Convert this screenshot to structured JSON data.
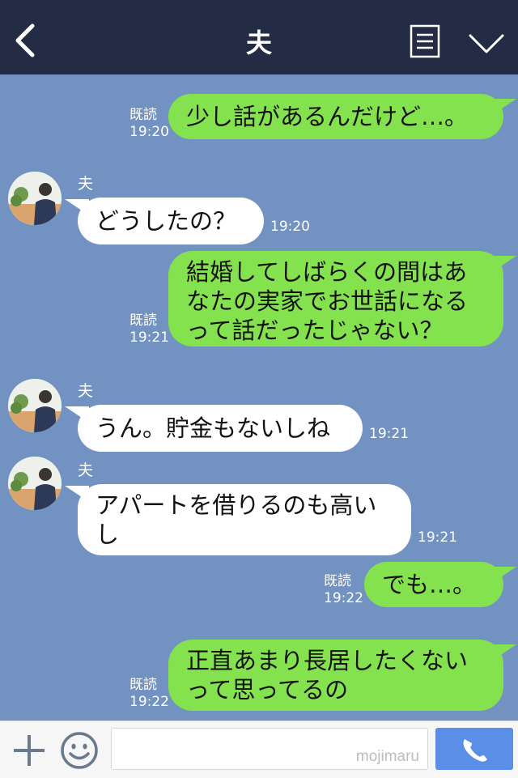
{
  "header": {
    "title": "夫",
    "icons": [
      "back-chevron-icon",
      "menu-list-icon",
      "chevron-down-icon"
    ]
  },
  "messages": [
    {
      "from": "me",
      "text": "少し話があるんだけど…。",
      "read": "既読",
      "time": "19:20"
    },
    {
      "from": "them",
      "name": "夫",
      "text": "どうしたの？",
      "time": "19:20"
    },
    {
      "from": "me",
      "lines": [
        "結婚してしばらくの間はあ",
        "なたの実家でお世話になる",
        "って話だったじゃない？"
      ],
      "read": "既読",
      "time": "19:21"
    },
    {
      "from": "them",
      "name": "夫",
      "text": "うん。貯金もないしね",
      "time": "19:21"
    },
    {
      "from": "them",
      "name": "夫",
      "lines": [
        "アパートを借りるのも高い",
        "し"
      ],
      "time": "19:21"
    },
    {
      "from": "me",
      "text": "でも…。",
      "read": "既読",
      "time": "19:22"
    },
    {
      "from": "me",
      "lines": [
        "正直あまり長居したくない",
        "って思ってるの"
      ],
      "read": "既読",
      "time": "19:22"
    }
  ],
  "footer": {
    "watermark": "mojimaru",
    "icons": [
      "plus-icon",
      "emoji-icon",
      "phone-icon"
    ]
  },
  "colors": {
    "background": "#7292c1",
    "header": "#232c44",
    "my_bubble": "#84e24f",
    "their_bubble": "#ffffff",
    "send_button": "#5b8ee6"
  }
}
